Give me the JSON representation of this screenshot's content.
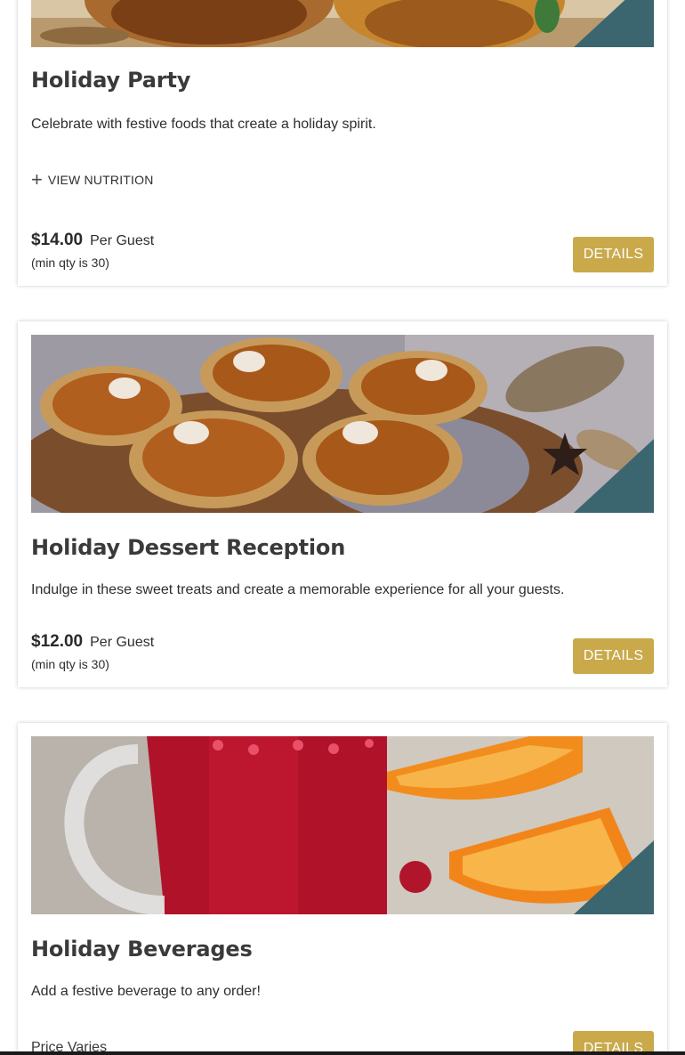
{
  "accent_color": "#c9a94a",
  "corner_badge_color": "#3b6670",
  "cards": [
    {
      "image_name": "holiday-party-food-image",
      "title": "Holiday Party",
      "description": "Celebrate with festive foods that create a holiday spirit.",
      "nutrition_label": "VIEW NUTRITION",
      "price": "$14.00",
      "price_unit": "Per Guest",
      "min_qty": "(min qty is 30)",
      "details_label": "DETAILS"
    },
    {
      "image_name": "pumpkin-tarts-image",
      "title": "Holiday Dessert Reception",
      "description": "Indulge in these sweet treats and create a memorable experience for all your guests.",
      "price": "$12.00",
      "price_unit": "Per Guest",
      "min_qty": "(min qty is 30)",
      "details_label": "DETAILS"
    },
    {
      "image_name": "cranberry-punch-image",
      "title": "Holiday Beverages",
      "description": "Add a festive beverage to any order!",
      "price_note": "Price Varies",
      "details_label": "DETAILS"
    }
  ]
}
